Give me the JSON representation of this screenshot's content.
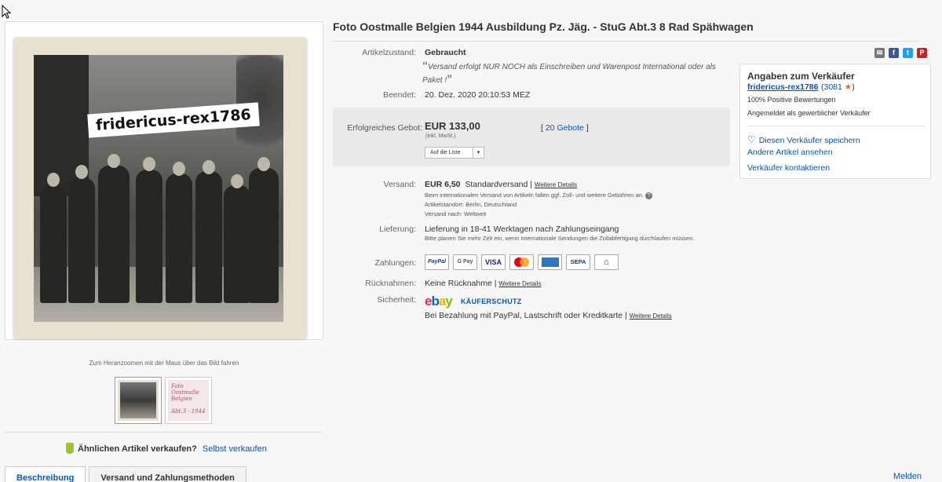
{
  "title": "Foto Oostmalle Belgien 1944 Ausbildung Pz. Jäg. - StuG Abt.3 8 Rad Spähwagen",
  "image": {
    "watermark": "fridericus-rex1786",
    "zoom_hint": "Zum Heranzoomen mit der Maus über das Bild fahren",
    "thumb2_lines": [
      "Foto Oostmalle",
      "Belgien",
      "Abt.3 · 1944"
    ]
  },
  "details": {
    "condition_label": "Artikelzustand:",
    "condition_value": "Gebraucht",
    "quote": "Versand erfolgt NUR NOCH als Einschreiben und Warenpost International oder als Paket !",
    "ended_label": "Beendet:",
    "ended_value": "20. Dez. 2020   20:10:53 MEZ",
    "bid_label": "Erfolgreiches Gebot:",
    "bid_price": "EUR 133,00",
    "bid_tax": "(inkl. MwSt.)",
    "bid_count_open": "[",
    "bid_count": "20 Gebote",
    "bid_count_close": "]",
    "watch_button": "Auf die Liste",
    "shipping_label": "Versand:",
    "shipping_cost": "EUR 6,50",
    "shipping_method": "Standardversand |",
    "shipping_more": "Weitere Details",
    "shipping_note": "Beim internationalen Versand von Artikeln fallen ggf. Zoll- und weitere Gebühren an.",
    "location": "Artikelstandort:  Berlin, Deutschland",
    "ships_to": "Versand nach:  Weltweit",
    "delivery_label": "Lieferung:",
    "delivery_value": "Lieferung in 18-41 Werktagen nach Zahlungseingang",
    "delivery_note": "Bitte planen Sie mehr Zeit ein, wenn internationale Sendungen die Zollabfertigung durchlaufen müssen.",
    "payment_label": "Zahlungen:",
    "payment_methods": [
      "PayPal",
      "G Pay",
      "VISA",
      "",
      "",
      "SEPA",
      "⌂"
    ],
    "returns_label": "Rücknahmen:",
    "returns_value": "Keine Rücknahme |",
    "returns_more": "Weitere Details",
    "security_label": "Sicherheit:",
    "ebay_logo": [
      "e",
      "b",
      "a",
      "y"
    ],
    "kaeuferschutz": "KÄUFERSCHUTZ",
    "security_value": "Bei Bezahlung mit PayPal, Lastschrift oder Kreditkarte |",
    "security_more": "Weitere Details"
  },
  "seller": {
    "heading": "Angaben zum Verkäufer",
    "name": "fridericus-rex1786",
    "score_open": "(",
    "score": "3081",
    "score_close": ")",
    "star": "★",
    "positive": "100% Positive Bewertungen",
    "business": "Angemeldet als gewerblicher Verkäufer",
    "save": "Diesen Verkäufer speichern",
    "other_items": "Andere Artikel ansehen",
    "contact": "Verkäufer kontaktieren"
  },
  "share_icons": [
    "mail-icon",
    "facebook-icon",
    "twitter-icon",
    "pinterest-icon"
  ],
  "share_glyphs": [
    "✉",
    "f",
    "t",
    "P"
  ],
  "bottom": {
    "similar_question": "Ähnlichen Artikel verkaufen?",
    "similar_link": "Selbst verkaufen",
    "tab_description": "Beschreibung",
    "tab_shipping": "Versand und Zahlungsmethoden",
    "report": "Melden"
  },
  "colors": {
    "link": "#0654ba",
    "star": "#e0632a",
    "bid_box": "#e9e9e9"
  }
}
